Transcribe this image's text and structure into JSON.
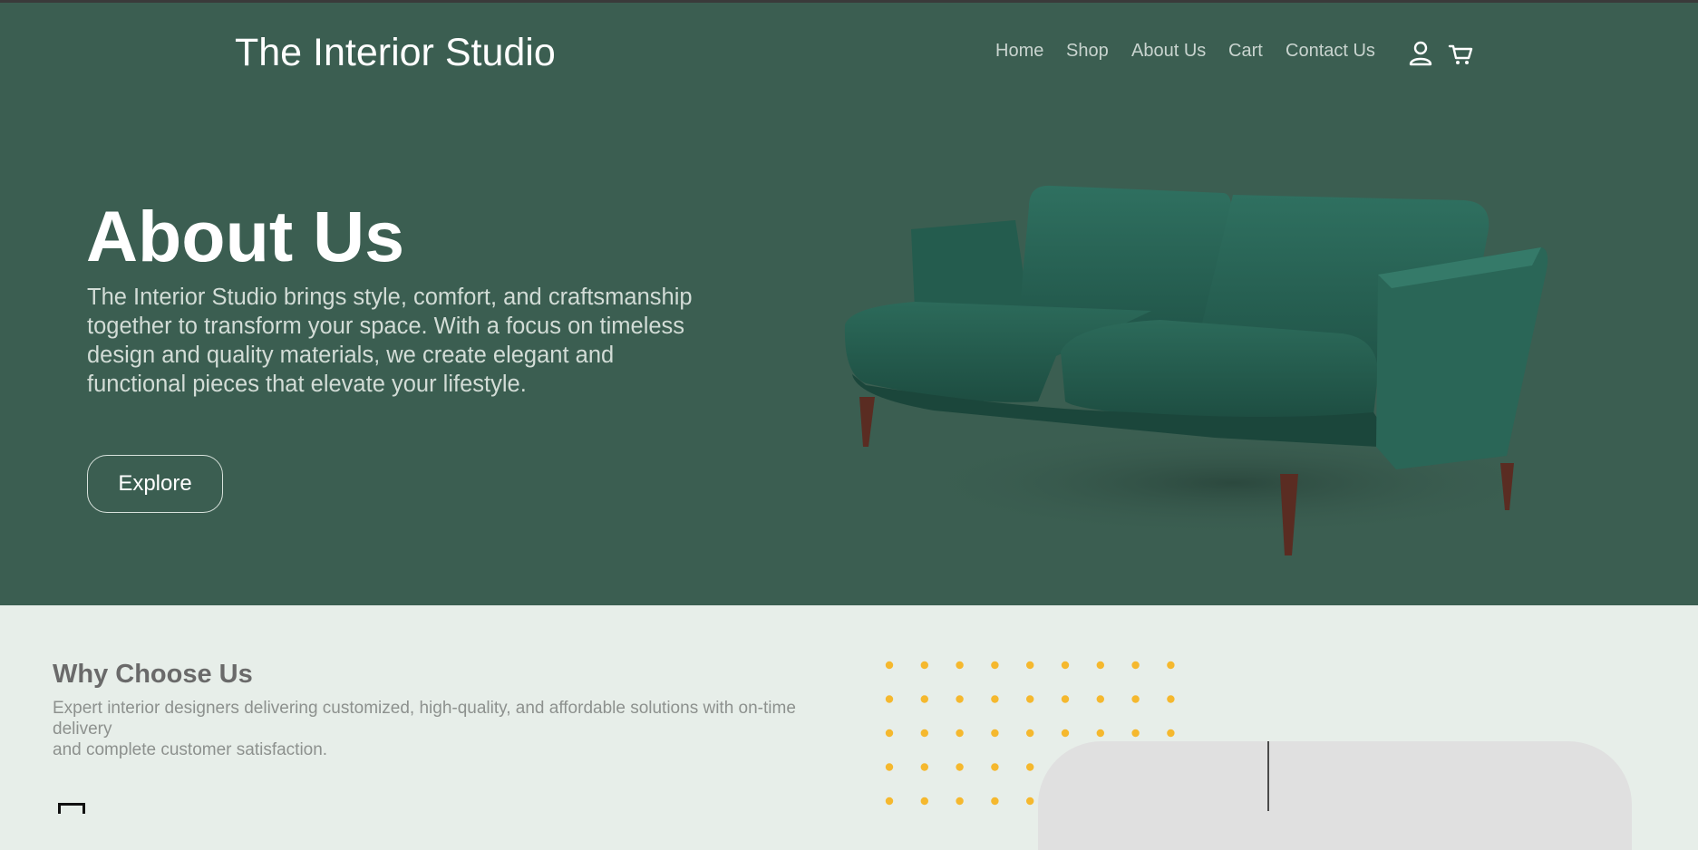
{
  "header": {
    "brand": "The Interior Studio",
    "nav": [
      {
        "label": "Home"
      },
      {
        "label": "Shop"
      },
      {
        "label": "About Us"
      },
      {
        "label": "Cart"
      },
      {
        "label": "Contact Us"
      }
    ],
    "icons": [
      "user-icon",
      "cart-icon"
    ]
  },
  "hero": {
    "title": "About Us",
    "text": "The Interior Studio brings style, comfort, and craftsmanship together to transform your space. With a focus on timeless design and quality materials, we create elegant and functional pieces that elevate your lifestyle.",
    "button_label": "Explore",
    "image": "green-velvet-sofa"
  },
  "why": {
    "title": "Why Choose Us",
    "text_lines": [
      "Expert interior designers delivering customized, high-quality, and affordable solutions with on-time delivery",
      "and complete customer satisfaction."
    ]
  },
  "colors": {
    "hero_bg": "#3b5e51",
    "page_bg": "#e7eee9",
    "accent_dots": "#f5b82e",
    "sofa": "#2b6455"
  }
}
